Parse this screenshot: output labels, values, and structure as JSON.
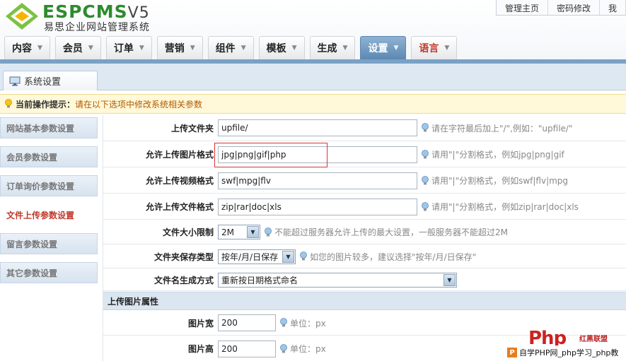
{
  "header": {
    "logo_esp": "ESP",
    "logo_cms": "CMS",
    "logo_ver": "V5",
    "logo_sub": "易思企业网站管理系统",
    "toplinks": [
      "管理主页",
      "密码修改",
      "我"
    ]
  },
  "nav": [
    {
      "label": "内容",
      "active": false
    },
    {
      "label": "会员",
      "active": false
    },
    {
      "label": "订单",
      "active": false
    },
    {
      "label": "营销",
      "active": false
    },
    {
      "label": "组件",
      "active": false
    },
    {
      "label": "模板",
      "active": false
    },
    {
      "label": "生成",
      "active": false
    },
    {
      "label": "设置",
      "active": true
    },
    {
      "label": "语言",
      "active": false
    }
  ],
  "subtab": {
    "label": "系统设置"
  },
  "tip": {
    "label": "当前操作提示：",
    "text": "请在以下选项中修改系统相关参数"
  },
  "sidebar": [
    {
      "label": "网站基本参数设置",
      "active": false
    },
    {
      "label": "会员参数设置",
      "active": false
    },
    {
      "label": "订单询价参数设置",
      "active": false
    },
    {
      "label": "文件上传参数设置",
      "active": true
    },
    {
      "label": "留言参数设置",
      "active": false
    },
    {
      "label": "其它参数设置",
      "active": false
    }
  ],
  "form": {
    "upload_dir": {
      "label": "上传文件夹",
      "value": "upfile/",
      "hint": "请在字符最后加上\"/\",例如：\"upfile/\""
    },
    "image_formats": {
      "label": "允许上传图片格式",
      "value": "jpg|png|gif|php",
      "hint": "请用\"|\"分割格式，例如jpg|png|gif"
    },
    "video_formats": {
      "label": "允许上传视频格式",
      "value": "swf|mpg|flv",
      "hint": "请用\"|\"分割格式，例如swf|flv|mpg"
    },
    "file_formats": {
      "label": "允许上传文件格式",
      "value": "zip|rar|doc|xls",
      "hint": "请用\"|\"分割格式，例如zip|rar|doc|xls"
    },
    "size_limit": {
      "label": "文件大小限制",
      "value": "2M",
      "hint": "不能超过服务器允许上传的最大设置，一般服务器不能超过2M"
    },
    "folder_type": {
      "label": "文件夹保存类型",
      "value": "按年/月/日保存",
      "hint": "如您的图片较多，建议选择\"按年/月/日保存\""
    },
    "naming": {
      "label": "文件名生成方式",
      "value": "重新按日期格式命名"
    },
    "image_section": "上传图片属性",
    "img_width": {
      "label": "图片宽",
      "value": "200",
      "hint": "单位：px"
    },
    "img_height": {
      "label": "图片高",
      "value": "200",
      "hint": "单位：px"
    }
  },
  "watermark": {
    "logo": "Php",
    "brand": "红黑联盟",
    "icon": "P",
    "text": "自学PHP网_php学习_php教"
  }
}
